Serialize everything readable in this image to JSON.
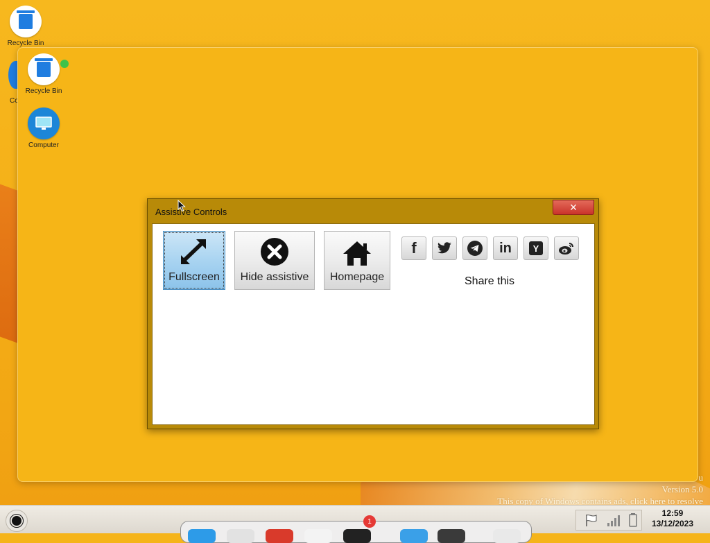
{
  "desktop": {
    "outer_icon": {
      "label": "Recycle Bin"
    },
    "partial_icon_label": "Co",
    "icons": [
      {
        "label": "Recycle Bin",
        "icon": "recycle-bin-icon"
      },
      {
        "label": "Computer",
        "icon": "computer-icon"
      }
    ]
  },
  "dialog": {
    "title": "Assistive Controls",
    "close_glyph": "×",
    "buttons": [
      {
        "label": "Fullscreen",
        "icon": "expand-arrows-icon"
      },
      {
        "label": "Hide assistive",
        "icon": "close-circle-icon"
      },
      {
        "label": "Homepage",
        "icon": "home-icon"
      }
    ],
    "share": {
      "label": "Share this",
      "networks": [
        "facebook",
        "twitter",
        "telegram",
        "linkedin",
        "hacker-news",
        "weibo"
      ],
      "hn_glyph": "Y",
      "linkedin_glyph": "in",
      "facebook_glyph": "f"
    }
  },
  "watermark": {
    "line1": "u",
    "line2": "Version 5.0",
    "line3": "This copy of Windows contains ads, click here to resolve"
  },
  "taskbar": {
    "time": "12:59",
    "date": "13/12/2023",
    "badge_count": "1"
  },
  "colors": {
    "desktop": "#f5b41a",
    "dialog_frame": "#b88a08",
    "close_red": "#d9443a",
    "active_button": "#a9d4f1"
  }
}
